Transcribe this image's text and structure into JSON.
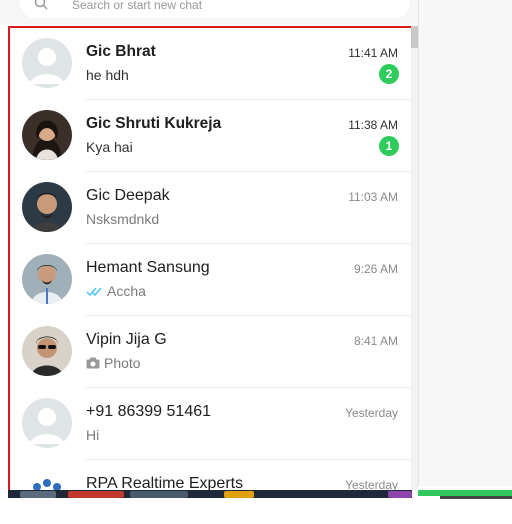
{
  "search": {
    "placeholder": "Search or start new chat"
  },
  "chats": [
    {
      "name": "Gic Bhrat",
      "time": "11:41 AM",
      "message": "he hdh",
      "unread": "2"
    },
    {
      "name": "Gic Shruti Kukreja",
      "time": "11:38 AM",
      "message": "Kya hai",
      "unread": "1"
    },
    {
      "name": "Gic Deepak",
      "time": "11:03 AM",
      "message": "Nsksmdnkd"
    },
    {
      "name": "Hemant Sansung",
      "time": "9:26 AM",
      "message": "Accha",
      "status_icon": "double-check-icon"
    },
    {
      "name": "Vipin Jija G",
      "time": "8:41 AM",
      "message": "Photo",
      "status_icon": "camera-icon"
    },
    {
      "name": "+91 86399 51461",
      "time": "Yesterday",
      "message": "Hi"
    },
    {
      "name": "RPA Realtime Experts",
      "time": "Yesterday"
    }
  ],
  "colors": {
    "unread_badge": "#2ecc5c",
    "selection_border": "#d81b1b",
    "read_ticks": "#4fc3f7"
  }
}
